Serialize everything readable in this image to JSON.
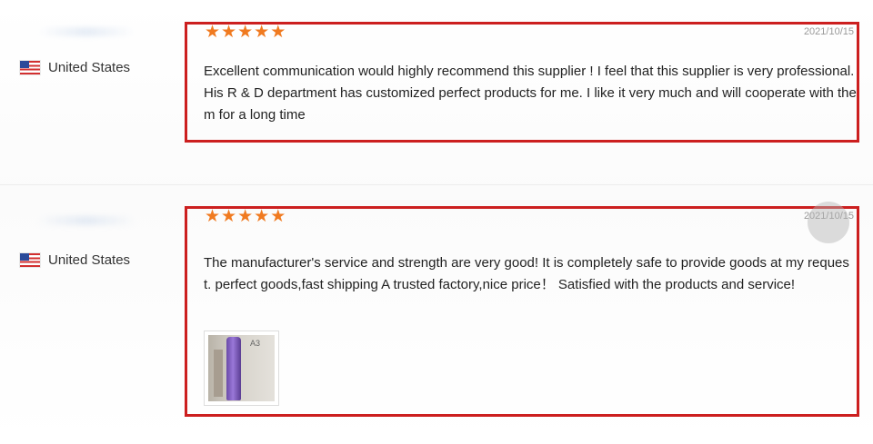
{
  "reviews": [
    {
      "country": "United States",
      "flag_icon": "us-flag-icon",
      "rating": 5,
      "stars": [
        "★",
        "★",
        "★",
        "★",
        "★"
      ],
      "date": "2021/10/15",
      "text": "Excellent communication would highly recommend this supplier ! I feel that this supplier is very professional. His R & D department has customized perfect products for me. I like it very much and will cooperate with them for a long time",
      "has_image": false
    },
    {
      "country": "United States",
      "flag_icon": "us-flag-icon",
      "rating": 5,
      "stars": [
        "★",
        "★",
        "★",
        "★",
        "★"
      ],
      "date": "2021/10/15",
      "text": "The manufacturer's service and strength are very good! It is completely safe to provide goods at my request. perfect goods,fast shipping A trusted factory,nice price！ Satisfied with the products and service!",
      "has_image": true,
      "image_label": "A3"
    }
  ],
  "colors": {
    "highlight_border": "#cc1f1f",
    "star": "#f07a20",
    "date": "#999999",
    "text": "#222222"
  }
}
